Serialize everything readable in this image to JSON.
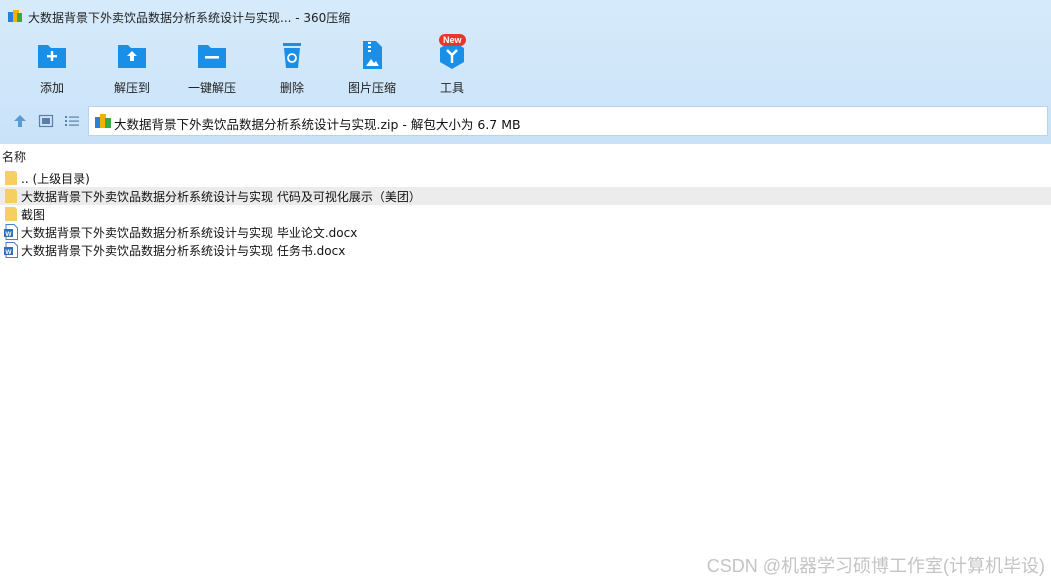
{
  "window": {
    "title": "大数据背景下外卖饮品数据分析系统设计与实现... - 360压缩"
  },
  "toolbar": {
    "items": [
      {
        "label": "添加",
        "icon": "add-icon"
      },
      {
        "label": "解压到",
        "icon": "extract-to-icon"
      },
      {
        "label": "一键解压",
        "icon": "one-click-extract-icon"
      },
      {
        "label": "删除",
        "icon": "delete-icon"
      },
      {
        "label": "图片压缩",
        "icon": "image-compress-icon"
      },
      {
        "label": "工具",
        "icon": "tools-icon",
        "badge": "New"
      }
    ]
  },
  "address": {
    "text": "大数据背景下外卖饮品数据分析系统设计与实现.zip - 解包大小为 6.7 MB"
  },
  "columns": {
    "name": "名称"
  },
  "files": [
    {
      "name": ".. (上级目录)",
      "type": "folder"
    },
    {
      "name": "大数据背景下外卖饮品数据分析系统设计与实现 代码及可视化展示（美团）",
      "type": "folder"
    },
    {
      "name": "截图",
      "type": "folder"
    },
    {
      "name": "大数据背景下外卖饮品数据分析系统设计与实现 毕业论文.docx",
      "type": "docx"
    },
    {
      "name": "大数据背景下外卖饮品数据分析系统设计与实现 任务书.docx",
      "type": "docx"
    }
  ],
  "watermark": "CSDN @机器学习硕博工作室(计算机毕设)",
  "colors": {
    "toolbar_bg": "#d6ebfb",
    "icon_blue": "#1a8fe8",
    "badge_red": "#e7372b",
    "folder_yellow": "#f6cf63",
    "selection": "#ececec"
  }
}
